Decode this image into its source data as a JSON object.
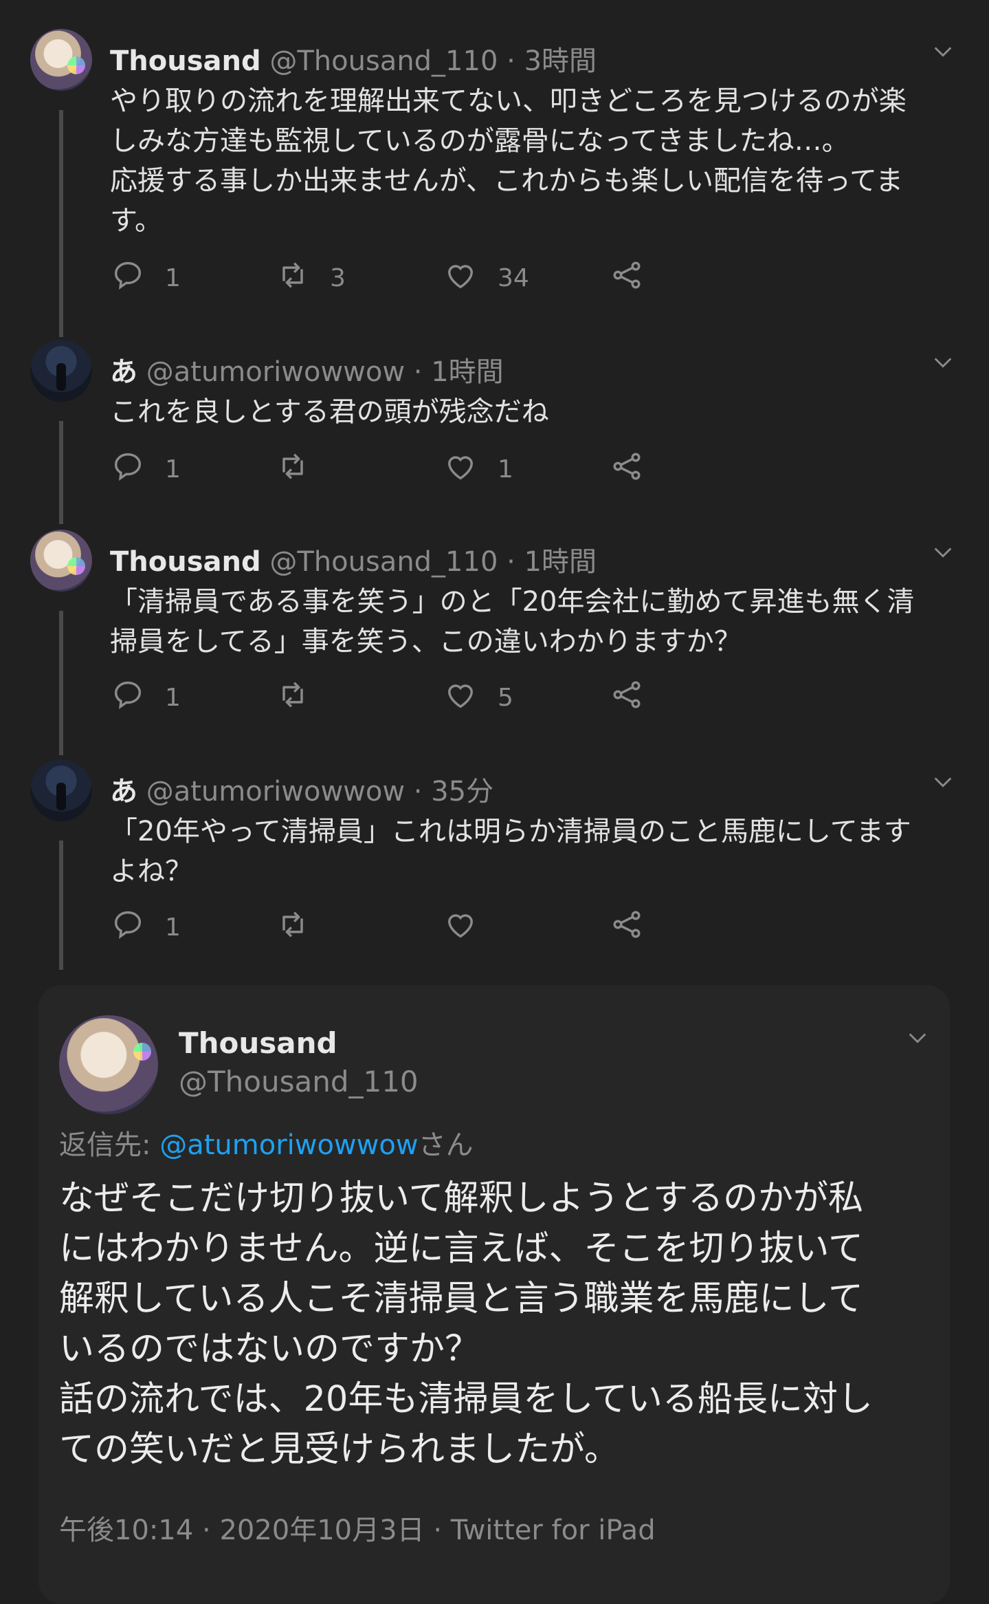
{
  "thread": [
    {
      "name": "Thousand",
      "handle": "@Thousand_110",
      "dot": "·",
      "time": "3時間",
      "avatar": "thousand",
      "text": [
        "やり取りの流れを理解出来てない、叩きどころを見つけるのが楽",
        "しみな方達も監視しているのが露骨になってきましたね…。",
        "応援する事しか出来ませんが、これからも楽しい配信を待ってま",
        "す。"
      ],
      "replies": "1",
      "retweets": "3",
      "likes": "34"
    },
    {
      "name": "あ",
      "handle": "@atumoriwowwow",
      "dot": "·",
      "time": "1時間",
      "avatar": "atumori",
      "text": [
        "これを良しとする君の頭が残念だね"
      ],
      "replies": "1",
      "retweets": "",
      "likes": "1"
    },
    {
      "name": "Thousand",
      "handle": "@Thousand_110",
      "dot": "·",
      "time": "1時間",
      "avatar": "thousand",
      "text": [
        "「清掃員である事を笑う」のと「20年会社に勤めて昇進も無く清",
        "掃員をしてる」事を笑う、この違いわかりますか？"
      ],
      "replies": "1",
      "retweets": "",
      "likes": "5"
    },
    {
      "name": "あ",
      "handle": "@atumoriwowwow",
      "dot": "·",
      "time": "35分",
      "avatar": "atumori",
      "text": [
        "「20年やって清掃員」これは明らか清掃員のこと馬鹿にしてます",
        "よね？"
      ],
      "replies": "1",
      "retweets": "",
      "likes": ""
    }
  ],
  "focused": {
    "name": "Thousand",
    "handle": "@Thousand_110",
    "reply_label": "返信先:",
    "reply_mention": "@atumoriwowwow",
    "reply_suffix": "さん",
    "text": [
      "なぜそこだけ切り抜いて解釈しようとするのかが私",
      "にはわかりません。逆に言えば、そこを切り抜いて",
      "解釈している人こそ清掃員と言う職業を馬鹿にして",
      "いるのではないのですか？",
      "話の流れでは、20年も清掃員をしている船長に対し",
      "ての笑いだと見受けられましたが。"
    ],
    "time": "午後10:14",
    "date": "2020年10月3日",
    "source": "Twitter for iPad",
    "dot": "·"
  },
  "icons": {
    "reply": "reply-icon",
    "retweet": "retweet-icon",
    "like": "heart-icon",
    "share": "share-icon",
    "menu": "chevron-down-icon"
  },
  "colors": {
    "background": "#202020",
    "mention": "#1da1f2",
    "muted": "#8b8b8b"
  }
}
